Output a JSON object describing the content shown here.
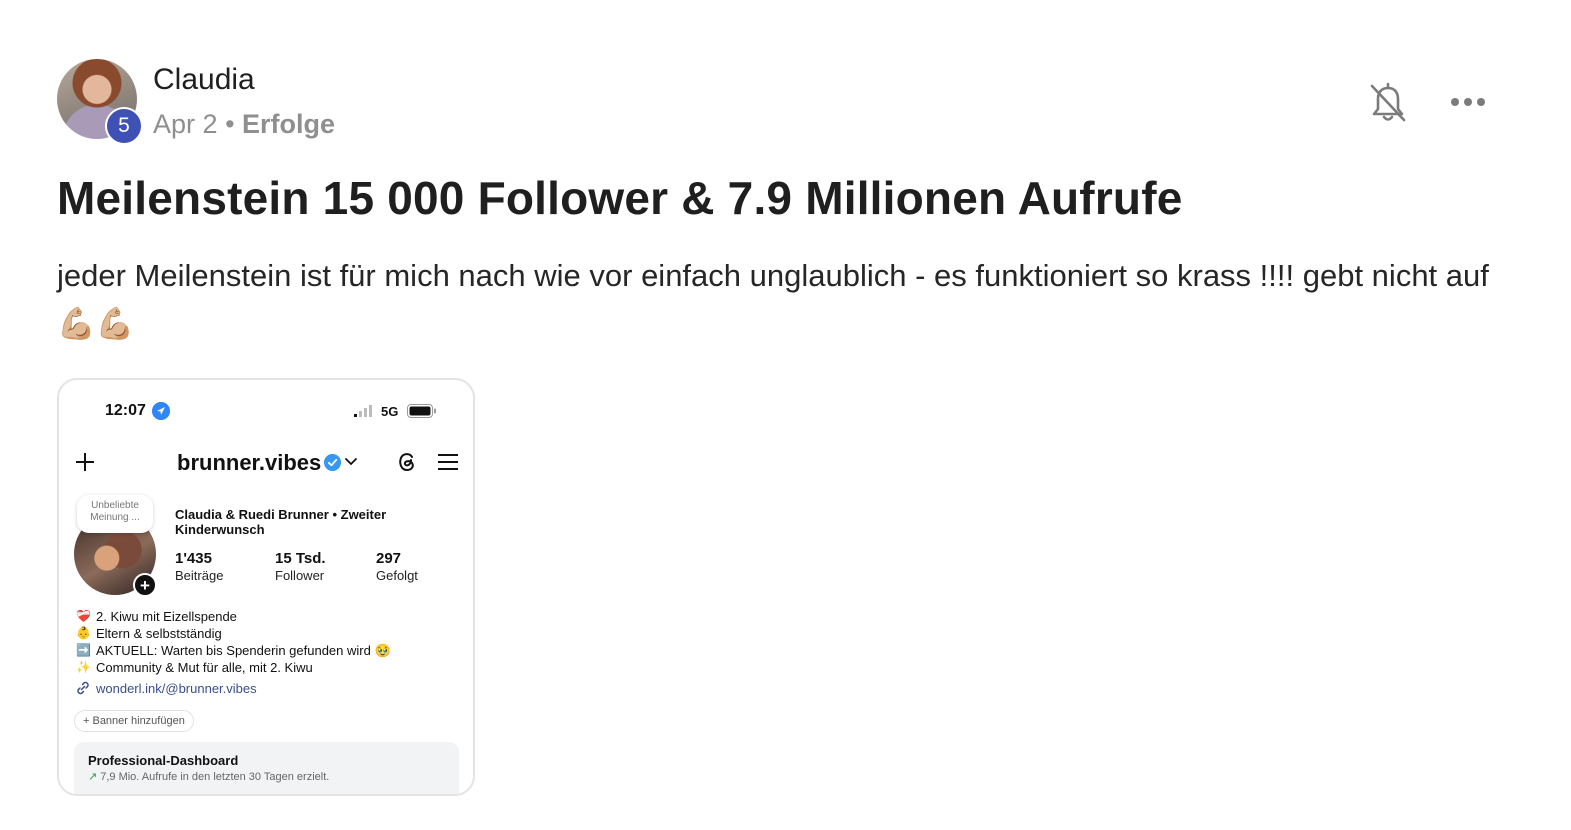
{
  "post": {
    "author": "Claudia",
    "level": "5",
    "date": "Apr 2",
    "separator": "•",
    "category": "Erfolge",
    "title": "Meilenstein 15 000 Follower & 7.9 Millionen Aufrufe",
    "body": "jeder Meilenstein ist für mich nach wie vor einfach unglaublich - es funktioniert so krass !!!! gebt nicht auf 💪🏼💪🏼",
    "icons": {
      "notify": "bell-off-icon",
      "more": "more-horizontal-icon"
    },
    "colors": {
      "level_badge": "#3f51b5",
      "text": "#1f1f1f",
      "muted": "#8f8f8f"
    }
  },
  "screenshot": {
    "status_bar": {
      "time": "12:07",
      "network": "5G"
    },
    "profile": {
      "username": "brunner.vibes",
      "note": "Unbeliebte Meinung ...",
      "display_name": "Claudia & Ruedi Brunner • Zweiter Kinderwunsch",
      "stats": [
        {
          "value": "1'435",
          "label": "Beiträge"
        },
        {
          "value": "15 Tsd.",
          "label": "Follower"
        },
        {
          "value": "297",
          "label": "Gefolgt"
        }
      ],
      "bio": [
        {
          "emoji": "❤️‍🩹",
          "text": "2. Kiwu mit Eizellspende"
        },
        {
          "emoji": "👶",
          "text": "Eltern & selbstständig"
        },
        {
          "emoji": "➡️",
          "text": "AKTUELL: Warten bis Spenderin gefunden wird 🥹"
        },
        {
          "emoji": "✨",
          "text": "Community & Mut für alle, mit 2. Kiwu"
        }
      ],
      "link": "wonderl.ink/@brunner.vibes",
      "banner_button": "+ Banner hinzufügen",
      "dashboard": {
        "title": "Professional-Dashboard",
        "subtitle": "7,9 Mio. Aufrufe in den letzten 30 Tagen erzielt."
      }
    }
  }
}
